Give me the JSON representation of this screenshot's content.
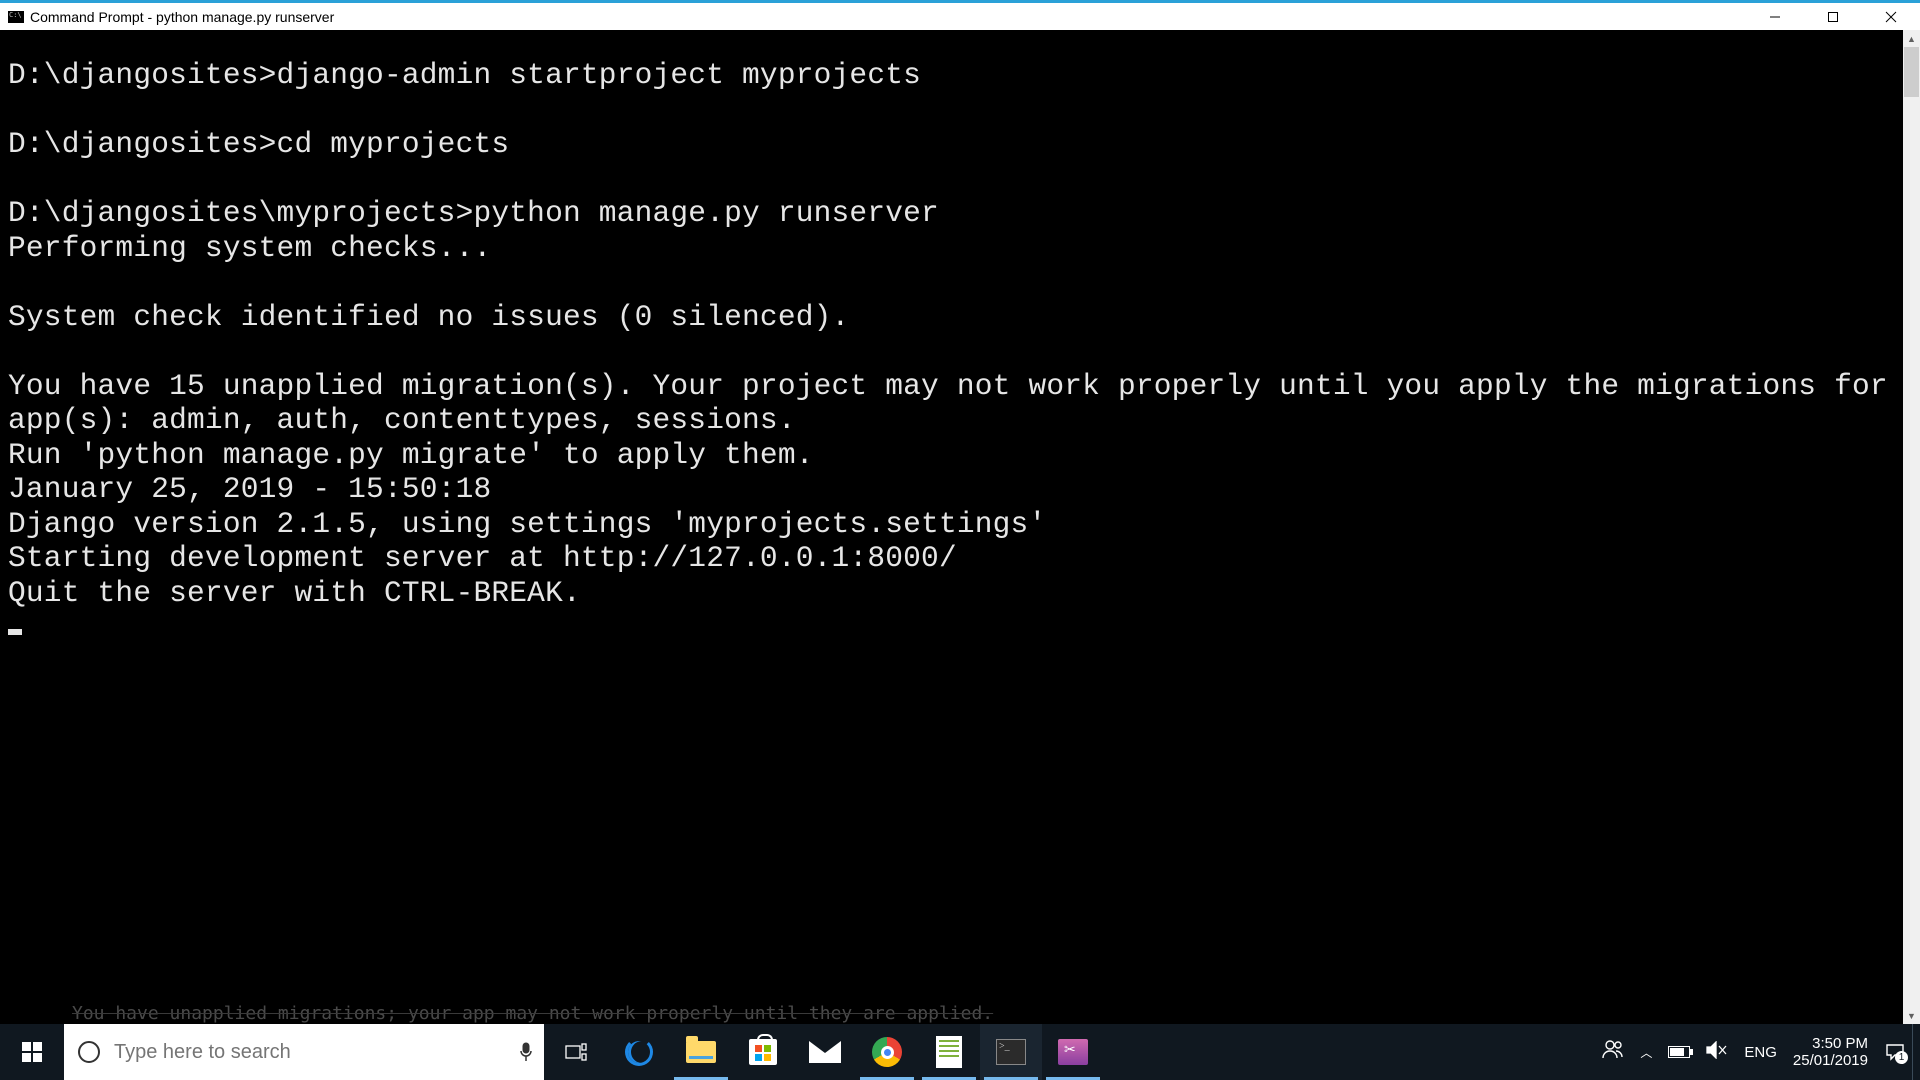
{
  "window": {
    "title": "Command Prompt - python  manage.py  runserver"
  },
  "terminal": {
    "lines": [
      "D:\\djangosites>django-admin startproject myprojects",
      "",
      "D:\\djangosites>cd myprojects",
      "",
      "D:\\djangosites\\myprojects>python manage.py runserver",
      "Performing system checks...",
      "",
      "System check identified no issues (0 silenced).",
      "",
      "You have 15 unapplied migration(s). Your project may not work properly until you apply the migrations for app(s): admin, auth, contenttypes, sessions.",
      "Run 'python manage.py migrate' to apply them.",
      "January 25, 2019 - 15:50:18",
      "Django version 2.1.5, using settings 'myprojects.settings'",
      "Starting development server at http://127.0.0.1:8000/",
      "Quit the server with CTRL-BREAK."
    ],
    "bg_hint": "You have unapplied migrations; your app may not work properly until they are applied."
  },
  "taskbar": {
    "search_placeholder": "Type here to search",
    "lang": "ENG",
    "time": "3:50 PM",
    "date": "25/01/2019",
    "notif_count": "1"
  }
}
